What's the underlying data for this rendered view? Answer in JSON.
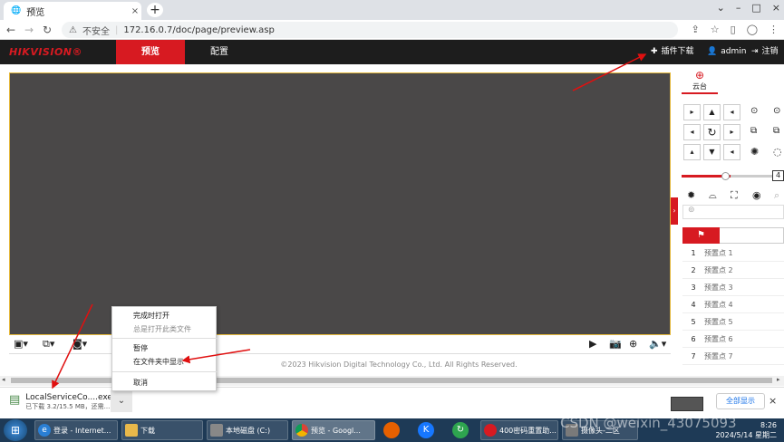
{
  "browser": {
    "tab_title": "预览",
    "tab_close": "×",
    "new_tab": "+",
    "window_controls": [
      "⌄",
      "–",
      "□",
      "×"
    ],
    "security_text": "不安全",
    "url": "172.16.0.7/doc/page/preview.asp"
  },
  "hik": {
    "logo": "HIKVISION®",
    "nav_preview": "预览",
    "nav_config": "配置",
    "plugin_download": "插件下载",
    "user": "admin",
    "logout": "注销",
    "accent_color": "#d71a21"
  },
  "ptz": {
    "tab_label": "云台",
    "speed_value": "4",
    "presets": [
      {
        "num": "1",
        "name": "预置点 1"
      },
      {
        "num": "2",
        "name": "预置点 2"
      },
      {
        "num": "3",
        "name": "预置点 3"
      },
      {
        "num": "4",
        "name": "预置点 4"
      },
      {
        "num": "5",
        "name": "预置点 5"
      },
      {
        "num": "6",
        "name": "预置点 6"
      },
      {
        "num": "7",
        "name": "预置点 7"
      }
    ]
  },
  "footer": {
    "copyright": "©2023 Hikvision Digital Technology Co., Ltd. All Rights Reserved."
  },
  "context_menu": {
    "items": [
      "完成时打开",
      "总是打开此类文件",
      "暂停",
      "在文件夹中显示",
      "取消"
    ]
  },
  "download": {
    "file_name": "LocalServiceCo....exe",
    "status": "已下载 3.2/15.5 MB，还需...",
    "show_all": "全部显示"
  },
  "taskbar": {
    "items": [
      "登录 - Internet...",
      "下载",
      "本地磁盘 (C:)",
      "预览 - Googl...",
      "400密码重置助...",
      "摄像头-二区"
    ],
    "time": "8:26",
    "date": "2024/5/14 星期二",
    "watermark": "CSDN @weixin_43075093"
  }
}
